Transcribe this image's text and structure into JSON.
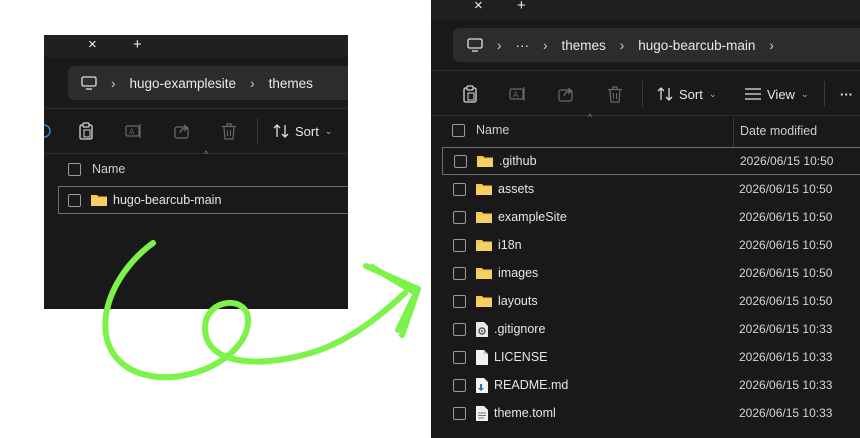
{
  "left_window": {
    "tab_close": "×",
    "tab_new": "+",
    "breadcrumb": [
      "hugo-examplesite",
      "themes"
    ],
    "toolbar": {
      "sort_label": "Sort"
    },
    "header": {
      "name": "Name"
    },
    "rows": [
      {
        "name": "hugo-bearcub-main",
        "type": "folder",
        "selected": true
      }
    ]
  },
  "right_window": {
    "tab_close": "×",
    "tab_new": "+",
    "breadcrumb": [
      "···",
      "themes",
      "hugo-bearcub-main"
    ],
    "toolbar": {
      "sort_label": "Sort",
      "view_label": "View",
      "more_label": "···"
    },
    "header": {
      "name": "Name",
      "date": "Date modified"
    },
    "rows": [
      {
        "name": ".github",
        "type": "folder",
        "date": "2026/06/15 10:50",
        "selected": true
      },
      {
        "name": "assets",
        "type": "folder",
        "date": "2026/06/15 10:50"
      },
      {
        "name": "exampleSite",
        "type": "folder",
        "date": "2026/06/15 10:50"
      },
      {
        "name": "i18n",
        "type": "folder",
        "date": "2026/06/15 10:50"
      },
      {
        "name": "images",
        "type": "folder",
        "date": "2026/06/15 10:50"
      },
      {
        "name": "layouts",
        "type": "folder",
        "date": "2026/06/15 10:50"
      },
      {
        "name": ".gitignore",
        "type": "config",
        "date": "2026/06/15 10:33"
      },
      {
        "name": "LICENSE",
        "type": "file",
        "date": "2026/06/15 10:33"
      },
      {
        "name": "README.md",
        "type": "markdown",
        "date": "2026/06/15 10:33"
      },
      {
        "name": "theme.toml",
        "type": "text",
        "date": "2026/06/15 10:33"
      }
    ]
  },
  "colors": {
    "arrow": "#7cf24a",
    "folder": "#f4c44e",
    "window_bg": "#191919"
  }
}
